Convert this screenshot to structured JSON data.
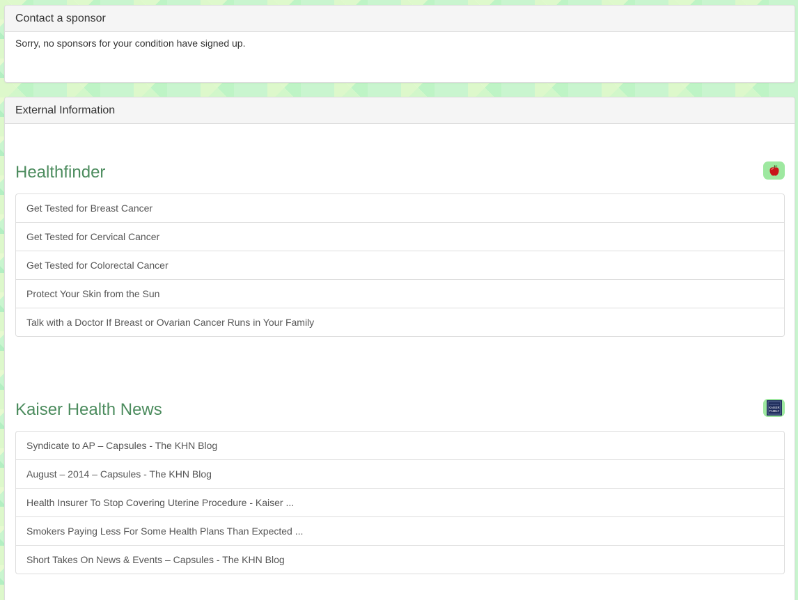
{
  "sponsor_panel": {
    "title": "Contact a sponsor",
    "message": "Sorry, no sponsors for your condition have signed up."
  },
  "external_panel": {
    "title": "External Information",
    "sources": [
      {
        "name": "Healthfinder",
        "logo_icon": "apple-icon",
        "items": [
          "Get Tested for Breast Cancer",
          "Get Tested for Cervical Cancer",
          "Get Tested for Colorectal Cancer",
          "Protect Your Skin from the Sun",
          "Talk with a Doctor If Breast or Ovarian Cancer Runs in Your Family"
        ]
      },
      {
        "name": "Kaiser Health News",
        "logo_icon": "kaiser-family-foundation-logo",
        "logo_text": [
          "KAISER",
          "FAMILY"
        ],
        "items": [
          "Syndicate to AP – Capsules - The KHN Blog",
          "August – 2014 – Capsules - The KHN Blog",
          "Health Insurer To Stop Covering Uterine Procedure - Kaiser ...",
          "Smokers Paying Less For Some Health Plans Than Expected ...",
          "Short Takes On News & Events – Capsules - The KHN Blog"
        ]
      }
    ]
  },
  "colors": {
    "source_title": "#4c8c5e",
    "logo_badge": "#9ee8a0",
    "background": "#c9f5cf"
  }
}
